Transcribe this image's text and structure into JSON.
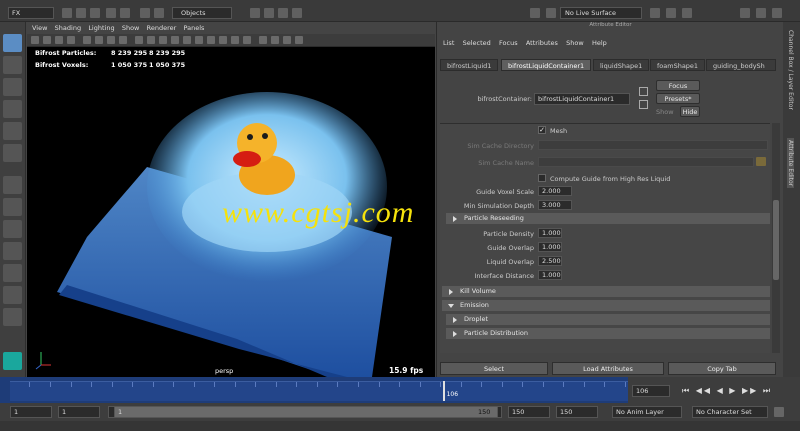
{
  "top": {
    "mode_value": "FX",
    "select_mode": "Objects",
    "live_surface": "No Live Surface"
  },
  "viewport": {
    "menu": [
      "View",
      "Shading",
      "Lighting",
      "Show",
      "Renderer",
      "Panels"
    ],
    "hud": {
      "particles_label": "Bifrost Particles:",
      "particles_a": "8 239 295",
      "particles_b": "8 239 295",
      "voxels_label": "Bifrost Voxels:",
      "voxels_a": "1 050 375",
      "voxels_b": "1 050 375"
    },
    "camera": "persp",
    "fps": "15.9 fps",
    "watermark": "www.cgtsj.com"
  },
  "attribute_editor": {
    "title": "Attribute Editor",
    "menu": [
      "List",
      "Selected",
      "Focus",
      "Attributes",
      "Show",
      "Help"
    ],
    "tabs": [
      "bifrostLiquid1",
      "bifrostLiquidContainer1",
      "liquidShape1",
      "foamShape1",
      "guiding_bodySh"
    ],
    "node_label": "bifrostContainer:",
    "node_value": "bifrostLiquidContainer1",
    "focus_btn": "Focus",
    "presets_btn": "Presets*",
    "show_label": "Show",
    "hide_btn": "Hide",
    "mesh_label": "Mesh",
    "sim_cache_dir_label": "Sim Cache Directory",
    "sim_cache_name_label": "Sim Cache Name",
    "compute_guide_label": "Compute Guide from High Res Liquid",
    "guide_voxel_scale_label": "Guide Voxel Scale",
    "guide_voxel_scale_value": "2.000",
    "min_sim_depth_label": "Min Simulation Depth",
    "min_sim_depth_value": "3.000",
    "particle_reseeding_label": "Particle Reseeding",
    "particle_density_label": "Particle Density",
    "particle_density_value": "1.000",
    "guide_overlap_label": "Guide Overlap",
    "guide_overlap_value": "1.000",
    "liquid_overlap_label": "Liquid Overlap",
    "liquid_overlap_value": "2.500",
    "interface_distance_label": "Interface Distance",
    "interface_distance_value": "1.000",
    "sections": [
      "Kill Volume",
      "Emission",
      "Droplet",
      "Particle Distribution"
    ],
    "select_btn": "Select",
    "load_attributes_btn": "Load Attributes",
    "copy_tab_btn": "Copy Tab"
  },
  "side_tabs": [
    "Channel Box / Layer Editor",
    "Attribute Editor"
  ],
  "timeline": {
    "current_frame": "106",
    "frame_field": "106",
    "range_start": "1",
    "playback_start": "1",
    "slider_start": "1",
    "slider_end": "150",
    "playback_end": "150",
    "range_end": "150",
    "anim_layer": "No Anim Layer",
    "character_set": "No Character Set",
    "progress": 0.7
  }
}
